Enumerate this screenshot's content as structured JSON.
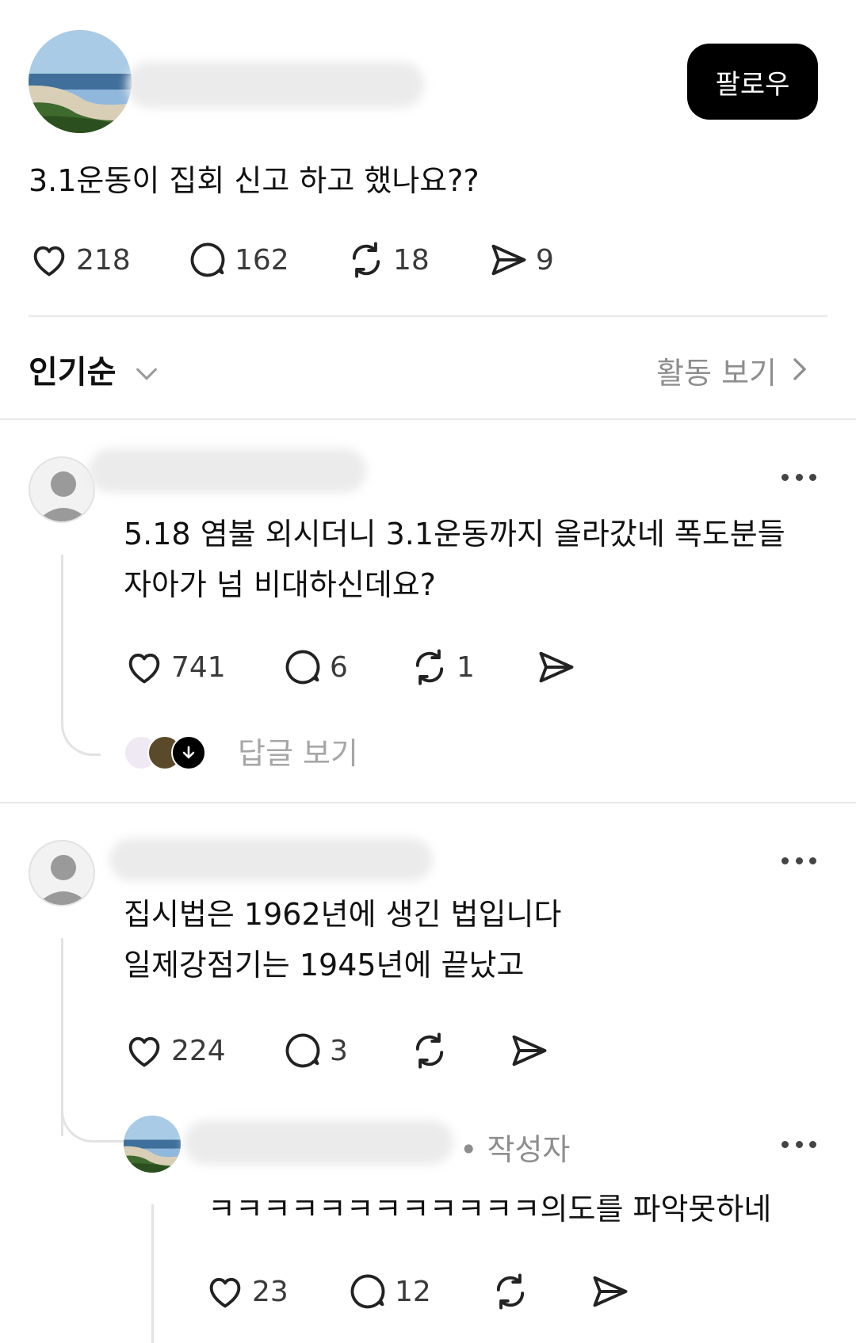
{
  "post": {
    "follow_label": "팔로우",
    "text": "3.1운동이 집회 신고 하고 했나요??",
    "likes": "218",
    "comments": "162",
    "reposts": "18",
    "shares": "9"
  },
  "sort": {
    "label": "인기순",
    "activity_label": "활동 보기"
  },
  "replies": [
    {
      "text_lines": [
        "5.18 염불 외시더니 3.1운동까지 올라갔네 폭도분들",
        "자아가 넘 비대하신데요?"
      ],
      "likes": "741",
      "comments": "6",
      "reposts": "1",
      "view_replies_label": "답글 보기"
    },
    {
      "text_lines": [
        "집시법은 1962년에 생긴 법입니다",
        "일제강점기는 1945년에 끝났고"
      ],
      "likes": "224",
      "comments": "3"
    }
  ],
  "nested_reply": {
    "author_badge": "• 작성자",
    "text": "ㅋㅋㅋㅋㅋㅋㅋㅋㅋㅋㅋㅋ의도를 파악못하네",
    "likes": "23",
    "comments": "12"
  }
}
